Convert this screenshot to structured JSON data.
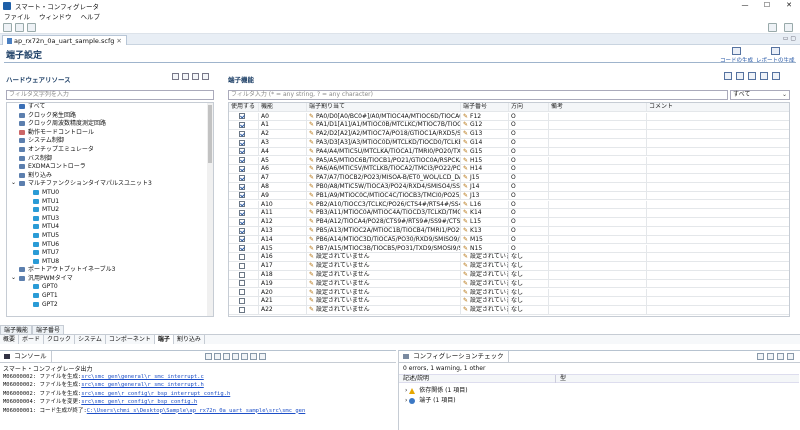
{
  "window": {
    "title": "スマート・コンフィグレータ"
  },
  "menu": [
    "ファイル",
    "ウィンドウ",
    "ヘルプ"
  ],
  "editor_tab": {
    "label": "ap_rx72n_0a_uart_sample.scfg"
  },
  "page": {
    "title": "端子設定",
    "gen_code": "コードの生成",
    "gen_report": "レポートの生成"
  },
  "hw": {
    "title": "ハードウェアリソース",
    "filter_placeholder": "フィルタ文字列を入力",
    "items": [
      {
        "label": "すべて",
        "level": 1,
        "color": "#3b6fb6"
      },
      {
        "label": "クロック発生回路",
        "level": 1,
        "color": "#5c7fae"
      },
      {
        "label": "クロック周波数精度測定回路",
        "level": 1,
        "color": "#5c7fae"
      },
      {
        "label": "動作モードコントロール",
        "level": 1,
        "color": "#c66"
      },
      {
        "label": "システム制御",
        "level": 1,
        "color": "#5c7fae"
      },
      {
        "label": "オンチップエミュレータ",
        "level": 1,
        "color": "#5c7fae"
      },
      {
        "label": "バス制御",
        "level": 1,
        "color": "#5c7fae"
      },
      {
        "label": "EXDMAコントローラ",
        "level": 1,
        "color": "#5c7fae"
      },
      {
        "label": "割り込み",
        "level": 1,
        "color": "#5c7fae"
      },
      {
        "label": "マルチファンクションタイマパルスユニット3",
        "level": 1,
        "color": "#5c7fae",
        "expanded": true
      },
      {
        "label": "MTU0",
        "level": 2,
        "color": "#2a9bd6"
      },
      {
        "label": "MTU1",
        "level": 2,
        "color": "#2a9bd6"
      },
      {
        "label": "MTU2",
        "level": 2,
        "color": "#2a9bd6"
      },
      {
        "label": "MTU3",
        "level": 2,
        "color": "#2a9bd6"
      },
      {
        "label": "MTU4",
        "level": 2,
        "color": "#2a9bd6"
      },
      {
        "label": "MTU5",
        "level": 2,
        "color": "#2a9bd6"
      },
      {
        "label": "MTU6",
        "level": 2,
        "color": "#2a9bd6"
      },
      {
        "label": "MTU7",
        "level": 2,
        "color": "#2a9bd6"
      },
      {
        "label": "MTU8",
        "level": 2,
        "color": "#2a9bd6"
      },
      {
        "label": "ポートアウトプットイネーブル3",
        "level": 1,
        "color": "#5c7fae"
      },
      {
        "label": "汎用PWMタイマ",
        "level": 1,
        "color": "#5c7fae",
        "expanded": true
      },
      {
        "label": "GPT0",
        "level": 2,
        "color": "#2a9bd6"
      },
      {
        "label": "GPT1",
        "level": 2,
        "color": "#2a9bd6"
      },
      {
        "label": "GPT2",
        "level": 2,
        "color": "#2a9bd6"
      }
    ]
  },
  "pins": {
    "title": "端子機能",
    "filter_placeholder": "フィルタ入力 (* = any string, ? = any character)",
    "filter_select": "すべて",
    "columns": [
      "使用する",
      "機能",
      "端子割り当て",
      "端子番号",
      "方向",
      "備考",
      "コメント"
    ],
    "rows": [
      {
        "use": true,
        "func": "A0",
        "assign": "PA0/D0[A0/BC0#]/A0/MTIOC4A/MTIOC6D/TIOCA0/P",
        "num": "F12",
        "dir": "O"
      },
      {
        "use": true,
        "func": "A1",
        "assign": "PA1/D1[A1]/A1/MTIOC0B/MTCLKC/MTIOC7B/TIOCB0",
        "num": "G12",
        "dir": "O"
      },
      {
        "use": true,
        "func": "A2",
        "assign": "PA2/D2[A2]/A2/MTIOC7A/PO18/GTIOC1A/RXD5/S",
        "num": "G13",
        "dir": "O"
      },
      {
        "use": true,
        "func": "A3",
        "assign": "PA3/D3[A3]/A3/MTIOC0D/MTCLKD/TIOCD0/TCLKB/PO1",
        "num": "G14",
        "dir": "O"
      },
      {
        "use": true,
        "func": "A4",
        "assign": "PA4/A4/MTIC5U/MTCLKA/TIOCA1/TMRI0/PO20/TXD",
        "num": "G15",
        "dir": "O"
      },
      {
        "use": true,
        "func": "A5",
        "assign": "PA5/A5/MTIOC6B/TIOCB1/PO21/GTIOC0A/RSPCKA-E",
        "num": "H15",
        "dir": "O"
      },
      {
        "use": true,
        "func": "A6",
        "assign": "PA6/A6/MTIC5V/MTCLKB/TIOCA2/TMCI3/PO22/POE",
        "num": "H14",
        "dir": "O"
      },
      {
        "use": true,
        "func": "A7",
        "assign": "PA7/A7/TIOCB2/PO23/MISOA-B/ET0_WOL/LCD_DAT",
        "num": "J15",
        "dir": "O"
      },
      {
        "use": true,
        "func": "A8",
        "assign": "PB0/A8/MTIC5W/TIOCA3/PO24/RXD4/SMISO4/SSCL",
        "num": "J14",
        "dir": "O"
      },
      {
        "use": true,
        "func": "A9",
        "assign": "PB1/A9/MTIOC0C/MTIOC4C/TIOCB3/TMCI0/PO25/TX",
        "num": "J13",
        "dir": "O"
      },
      {
        "use": true,
        "func": "A10",
        "assign": "PB2/A10/TIOCC3/TCLKC/PO26/CTS4#/RTS4#/SS4#",
        "num": "L16",
        "dir": "O"
      },
      {
        "use": true,
        "func": "A11",
        "assign": "PB3/A11/MTIOC0A/MTIOC4A/TIOCD3/TCLKD/TMO0/",
        "num": "K14",
        "dir": "O"
      },
      {
        "use": true,
        "func": "A12",
        "assign": "PB4/A12/TIOCA4/PO28/CTS9#/RTS9#/SS9#/CTS11#",
        "num": "L15",
        "dir": "O"
      },
      {
        "use": true,
        "func": "A13",
        "assign": "PB5/A13/MTIOC2A/MTIOC1B/TIOCB4/TMRI1/PO29/",
        "num": "K13",
        "dir": "O"
      },
      {
        "use": true,
        "func": "A14",
        "assign": "PB6/A14/MTIOC3D/TIOCA5/PO30/RXD9/SMISO9/SSC",
        "num": "M15",
        "dir": "O"
      },
      {
        "use": true,
        "func": "A15",
        "assign": "PB7/A15/MTIOC3B/TIOCB5/PO31/TXD9/SMOSI9/SSD",
        "num": "N15",
        "dir": "O"
      },
      {
        "use": false,
        "func": "A16",
        "assign": "設定されていません",
        "num": "設定されていま",
        "dir": "なし"
      },
      {
        "use": false,
        "func": "A17",
        "assign": "設定されていません",
        "num": "設定されていま",
        "dir": "なし"
      },
      {
        "use": false,
        "func": "A18",
        "assign": "設定されていません",
        "num": "設定されていま",
        "dir": "なし"
      },
      {
        "use": false,
        "func": "A19",
        "assign": "設定されていません",
        "num": "設定されていま",
        "dir": "なし"
      },
      {
        "use": false,
        "func": "A20",
        "assign": "設定されていません",
        "num": "設定されていま",
        "dir": "なし"
      },
      {
        "use": false,
        "func": "A21",
        "assign": "設定されていません",
        "num": "設定されていま",
        "dir": "なし"
      },
      {
        "use": false,
        "func": "A22",
        "assign": "設定されていません",
        "num": "設定されていま",
        "dir": "なし"
      }
    ]
  },
  "view_tabs": [
    "端子機能",
    "端子番号"
  ],
  "bottom_tabs": [
    "概要",
    "ボード",
    "クロック",
    "システム",
    "コンポーネント",
    "端子",
    "割り込み"
  ],
  "bottom_tab_active": "端子",
  "console": {
    "tab": "コンソール",
    "subtitle": "スマート・コンフィグレータ出力",
    "lines": [
      {
        "code": "M06000002:",
        "text": "ファイルを生成:",
        "path": "src\\smc_gen\\general\\r_smc_interrupt.c"
      },
      {
        "code": "M06000002:",
        "text": "ファイルを生成:",
        "path": "src\\smc_gen\\general\\r_smc_interrupt.h"
      },
      {
        "code": "M06000002:",
        "text": "ファイルを生成:",
        "path": "src\\smc_gen\\r_config\\r_bsp_interrupt_config.h"
      },
      {
        "code": "M06000004:",
        "text": "ファイルを変更:",
        "path": "src\\smc_gen\\r_config\\r_bsp_config.h"
      },
      {
        "code": "M06000001:",
        "text": "コード生成が終了:",
        "path": "C:\\Users\\chmi_s\\Desktop\\Sample\\ap_rx72n_0a_uart_sample\\src\\smc_gen"
      }
    ]
  },
  "config": {
    "tab": "コンフィグレーションチェック",
    "summary": "0 errors, 1 warning, 1 other",
    "col_desc": "記述/説明",
    "col_type": "型",
    "items": [
      {
        "label": "依存関係 (1 項目)",
        "kind": "warning"
      },
      {
        "label": "端子 (1 項目)",
        "kind": "info"
      }
    ]
  }
}
